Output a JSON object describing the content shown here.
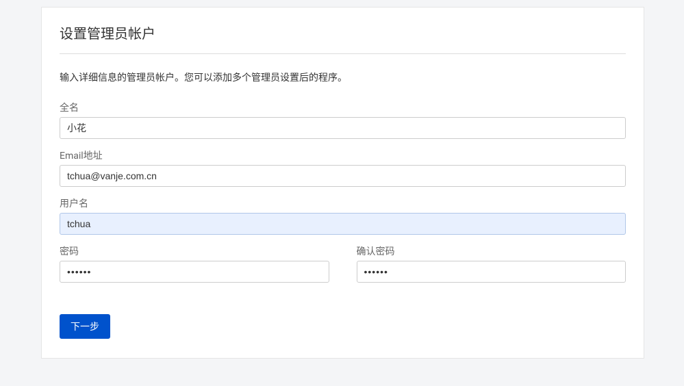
{
  "page": {
    "title": "设置管理员帐户",
    "description": "输入详细信息的管理员帐户。您可以添加多个管理员设置后的程序。"
  },
  "form": {
    "fullname": {
      "label": "全名",
      "value": "小花"
    },
    "email": {
      "label": "Email地址",
      "value": "tchua@vanje.com.cn"
    },
    "username": {
      "label": "用户名",
      "value": "tchua"
    },
    "password": {
      "label": "密码",
      "value": "••••••"
    },
    "confirm_password": {
      "label": "确认密码",
      "value": "••••••"
    }
  },
  "actions": {
    "next": "下一步"
  }
}
